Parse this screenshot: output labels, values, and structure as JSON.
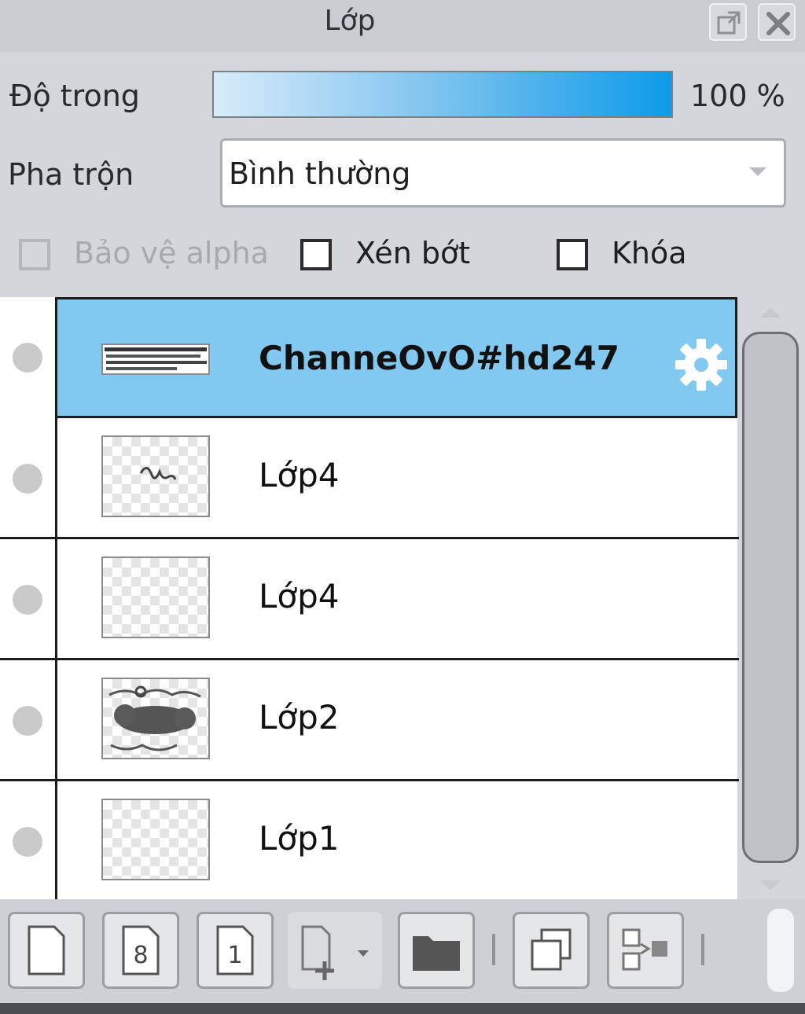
{
  "panel": {
    "title": "Lớp"
  },
  "opacity": {
    "label": "Độ trong",
    "value": "100 %",
    "level": 1.0
  },
  "blend": {
    "label": "Pha trộn",
    "value": "Bình thường"
  },
  "options": {
    "alpha_protect": {
      "label": "Bảo vệ alpha",
      "checked": false,
      "disabled": true
    },
    "clip": {
      "label": "Xén bớt",
      "checked": false
    },
    "lock": {
      "label": "Khóa",
      "checked": false
    }
  },
  "layers": [
    {
      "name": "ChanneOvO#hd247",
      "selected": true
    },
    {
      "name": "Lớp4",
      "selected": false
    },
    {
      "name": "Lớp4",
      "selected": false
    },
    {
      "name": "Lớp2",
      "selected": false
    },
    {
      "name": "Lớp1",
      "selected": false
    }
  ],
  "toolbar": {
    "icons": [
      "new-layer-icon",
      "new-8bit-layer-icon",
      "new-1bit-layer-icon",
      "add-layer-dropdown-icon",
      "new-folder-icon",
      "duplicate-layer-icon",
      "merge-down-icon"
    ],
    "new_8bit_glyph": "8",
    "new_1bit_glyph": "1"
  },
  "colors": {
    "selected_row": "#82c9f1",
    "slider_start": "#d7ecfa",
    "slider_end": "#0c9be8"
  }
}
